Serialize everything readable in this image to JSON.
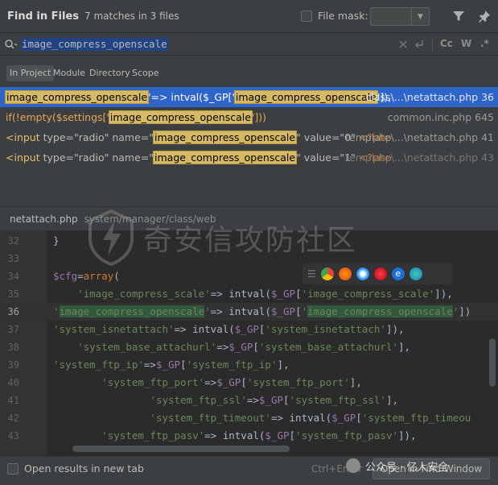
{
  "header": {
    "title": "Find in Files",
    "subtitle": "7 matches in 3 files",
    "file_mask_label": "File mask:",
    "file_mask_value": ""
  },
  "search": {
    "query": "image_compress_openscale",
    "options": {
      "match_case": "Cc",
      "words": "W",
      "regex": ".*"
    }
  },
  "scope_tabs": [
    {
      "label": "In Project",
      "active": true
    },
    {
      "label": "Module",
      "active": false
    },
    {
      "label": "Directory",
      "active": false
    },
    {
      "label": "Scope",
      "active": false
    }
  ],
  "results": [
    {
      "pre": "",
      "match": "image_compress_openscale",
      "mid": "'=> intval($_GP['",
      "match2": "image_compress_openscale",
      "post": "']),",
      "location": "class\\...\\netattach.php 36",
      "selected": true
    },
    {
      "pre": "if(!empty($settings['",
      "match": "image_compress_openscale",
      "post": "']))",
      "location": "common.inc.php 645",
      "selected": false
    },
    {
      "pre_tag": "<input",
      "pre_attrs": " type=\"radio\" name=\"",
      "match": "image_compress_openscale",
      "post": "\" value=\"0\" ",
      "php": "<?php",
      "location": "template\\...\\netattach.php 41",
      "selected": false
    },
    {
      "pre_tag": "<input",
      "pre_attrs": " type=\"radio\" name=\"",
      "match": "image_compress_openscale",
      "post": "\" value=\"1\" ",
      "php": "<?php",
      "location": "template\\...\\netattach.php 43",
      "selected": false
    }
  ],
  "preview": {
    "file_name": "netattach.php",
    "file_path": "system/manager/class/web",
    "lines": [
      {
        "num": "32",
        "code": "}"
      },
      {
        "num": "33",
        "code": ""
      },
      {
        "num": "34",
        "code": "$cfg=array("
      },
      {
        "num": "35",
        "code": "    'image_compress_scale'=> intval($_GP['image_compress_scale']),"
      },
      {
        "num": "36",
        "code": "'image_compress_openscale'=> intval($_GP['image_compress_openscale'])"
      },
      {
        "num": "37",
        "code": "'system_isnetattach'=> intval($_GP['system_isnetattach']),"
      },
      {
        "num": "38",
        "code": "    'system_base_attachurl'=>$_GP['system_base_attachurl'],"
      },
      {
        "num": "39",
        "code": "'system_ftp_ip'=>$_GP['system_ftp_ip'],"
      },
      {
        "num": "40",
        "code": "        'system_ftp_port'=>$_GP['system_ftp_port'],"
      },
      {
        "num": "41",
        "code": "                'system_ftp_ssl'=>$_GP['system_ftp_ssl'],"
      },
      {
        "num": "42",
        "code": "                'system_ftp_timeout'=> intval($_GP['system_ftp_timeou"
      },
      {
        "num": "43",
        "code": "        'system_ftp_pasv'=> intval($_GP['system_ftp_pasv']),"
      }
    ]
  },
  "watermark": {
    "text": "奇安信攻防社区"
  },
  "overlay": {
    "wechat_text": "公众号 · 亿人安全"
  },
  "footer": {
    "open_in_new_tab": "Open results in new tab",
    "shortcut": "Ctrl+Enter",
    "open_button": "Open in Find Window"
  }
}
